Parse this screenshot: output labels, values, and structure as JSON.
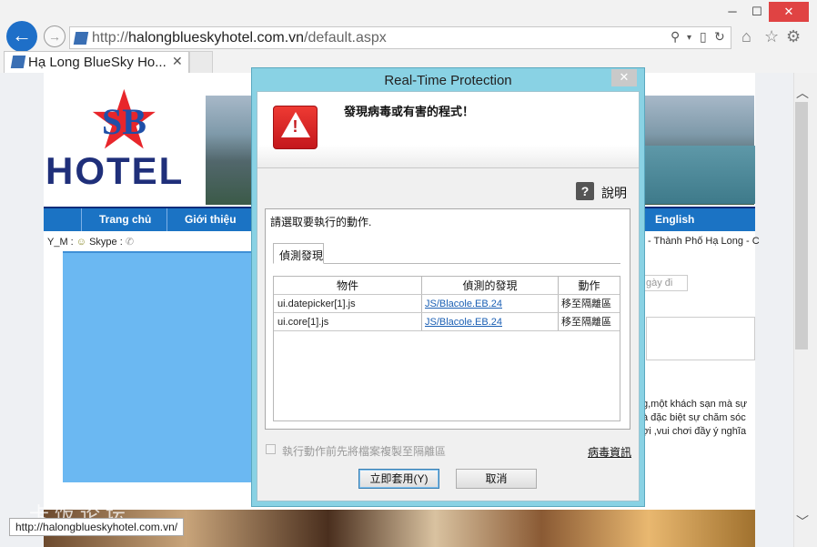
{
  "window": {
    "minimize": "─",
    "maximize": "☐",
    "close": "✕"
  },
  "browser": {
    "url_prefix": "http://",
    "url_host": "halongblueskyhotel.com.vn",
    "url_path": "/default.aspx",
    "tab_title": "Hạ Long BlueSky Ho...",
    "status_url": "http://halongblueskyhotel.com.vn/"
  },
  "site": {
    "logo_text": "HOTEL",
    "logo_mark": "SB",
    "menu": [
      "Trang chủ",
      "Giới thiệu",
      "English"
    ],
    "chat_prefix": "Y_M :",
    "chat_skype": "Skype :",
    "location_text": "- Thành Phố Hạ Long - C",
    "date_placeholder": "gày đi",
    "desc_lines": [
      "g,một khách sạn mà sự",
      "à đặc biệt sự chăm sóc",
      "ợi ,vui chơi đầy ý nghĩa"
    ],
    "watermark": "卡饭论坛"
  },
  "dialog": {
    "title": "Real-Time Protection",
    "close": "✕",
    "heading": "發現病毒或有害的程式！",
    "help_label": "說明",
    "instruction": "請選取要執行的動作.",
    "tab_label": "偵測發現",
    "columns": [
      "物件",
      "偵測的發現",
      "動作"
    ],
    "rows": [
      {
        "object": "ui.datepicker[1].js",
        "finding": "JS/Blacole.EB.24",
        "action": "移至隔離區"
      },
      {
        "object": "ui.core[1].js",
        "finding": "JS/Blacole.EB.24",
        "action": "移至隔離區"
      }
    ],
    "checkbox_label": "執行動作前先將檔案複製至隔離區",
    "virus_info_link": "病毒資訊",
    "apply_button": "立即套用(Y)",
    "cancel_button": "取消"
  },
  "colors": {
    "accent": "#1b73c4",
    "dialog_frame": "#89d2e4",
    "warning": "#d9211f"
  }
}
